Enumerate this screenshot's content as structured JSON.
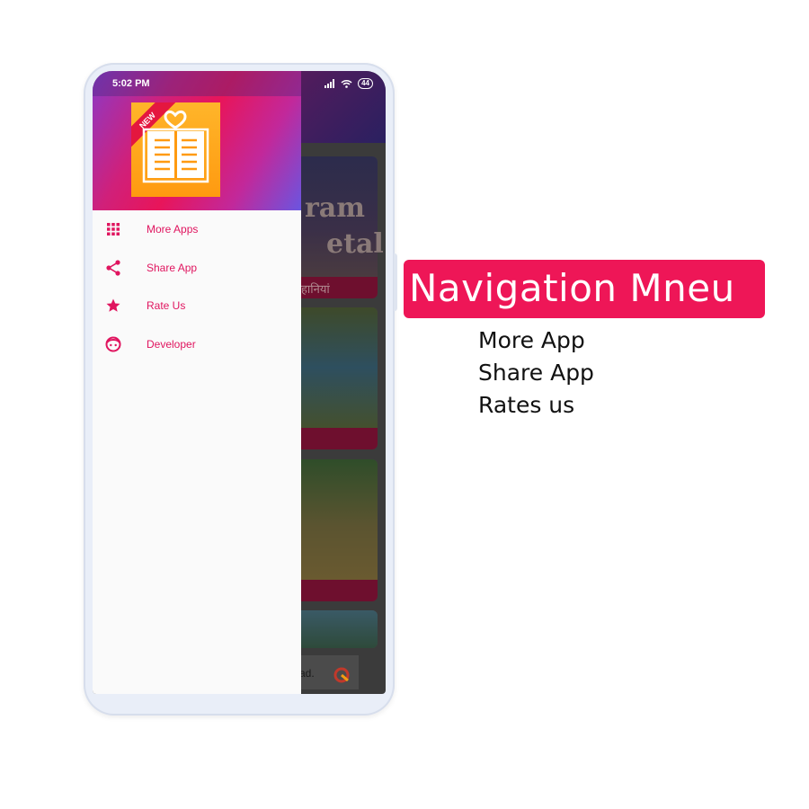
{
  "status_bar": {
    "time": "5:02 PM",
    "battery": "44"
  },
  "drawer": {
    "logo_badge": "NEW",
    "items": [
      {
        "label": "More Apps",
        "icon": "grid-icon"
      },
      {
        "label": "Share App",
        "icon": "share-icon"
      },
      {
        "label": "Rate Us",
        "icon": "star-icon"
      },
      {
        "label": "Developer",
        "icon": "face-icon"
      }
    ]
  },
  "background_app": {
    "card1_text": "ram",
    "card1_text2": "etal",
    "card1_caption": "हानियां",
    "ad_text": "ad."
  },
  "annotation": {
    "title": "Navigation Mneu",
    "features": [
      "More App",
      "Share App",
      "Rates us"
    ]
  },
  "colors": {
    "accent": "#ee1657",
    "menu_text": "#e0155f",
    "logo": "#ff9a10"
  }
}
